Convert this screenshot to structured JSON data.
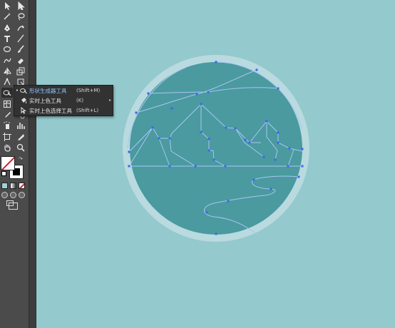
{
  "toolbar": {
    "tools": [
      {
        "name": "selection-tool-icon",
        "glyph": "arrow"
      },
      {
        "name": "direct-selection-tool-icon",
        "glyph": "arrow-hollow"
      },
      {
        "name": "magic-wand-tool-icon",
        "glyph": "wand"
      },
      {
        "name": "lasso-tool-icon",
        "glyph": "lasso"
      },
      {
        "name": "pen-tool-icon",
        "glyph": "pen"
      },
      {
        "name": "curvature-tool-icon",
        "glyph": "curve"
      },
      {
        "name": "type-tool-icon",
        "glyph": "T"
      },
      {
        "name": "line-segment-tool-icon",
        "glyph": "line"
      },
      {
        "name": "ellipse-tool-icon",
        "glyph": "ellipse"
      },
      {
        "name": "paintbrush-tool-icon",
        "glyph": "brush"
      },
      {
        "name": "shaper-tool-icon",
        "glyph": "shaper"
      },
      {
        "name": "eraser-tool-icon",
        "glyph": "eraser"
      },
      {
        "name": "reflect-tool-icon",
        "glyph": "reflect"
      },
      {
        "name": "scale-tool-icon",
        "glyph": "scale"
      },
      {
        "name": "puppet-warp-tool-icon",
        "glyph": "warp"
      },
      {
        "name": "free-transform-tool-icon",
        "glyph": "transform"
      },
      {
        "name": "shape-builder-tool-icon",
        "glyph": "shapebuilder"
      },
      {
        "name": "perspective-grid-tool-icon",
        "glyph": "grid"
      },
      {
        "name": "mesh-tool-icon",
        "glyph": "mesh"
      },
      {
        "name": "gradient-tool-icon",
        "glyph": "gradient"
      },
      {
        "name": "eyedropper-tool-icon",
        "glyph": "eyedropper"
      },
      {
        "name": "blend-tool-icon",
        "glyph": "blend"
      },
      {
        "name": "symbol-sprayer-tool-icon",
        "glyph": "spray"
      },
      {
        "name": "column-graph-tool-icon",
        "glyph": "graph"
      },
      {
        "name": "artboard-tool-icon",
        "glyph": "artboard"
      },
      {
        "name": "slice-tool-icon",
        "glyph": "slice"
      },
      {
        "name": "hand-tool-icon",
        "glyph": "hand"
      },
      {
        "name": "zoom-tool-icon",
        "glyph": "zoom"
      }
    ],
    "fill_stroke": {
      "fill": "#ffffff",
      "stroke": "#000000",
      "none_slash": "#d11f2b"
    },
    "color_modes": [
      "color",
      "gradient",
      "none"
    ],
    "draw_modes": [
      "draw-normal",
      "draw-behind",
      "draw-inside"
    ]
  },
  "flyout": {
    "items": [
      {
        "label": "形状生成器工具",
        "shortcut": "(Shift+M)",
        "selected": true,
        "icon": "shape-builder-icon"
      },
      {
        "label": "实时上色工具",
        "shortcut": "(K)",
        "selected": false,
        "icon": "live-paint-bucket-icon",
        "has_submenu": true
      },
      {
        "label": "实时上色选择工具",
        "shortcut": "(Shift+L)",
        "selected": false,
        "icon": "live-paint-selection-icon"
      }
    ]
  },
  "artwork": {
    "background": "#94c9cd",
    "outer_ring_color": "#b9dadf",
    "inner_disc_color": "#4a9aa0",
    "path_color": "#a9c6f4",
    "anchor_color": "#3b67e8"
  }
}
